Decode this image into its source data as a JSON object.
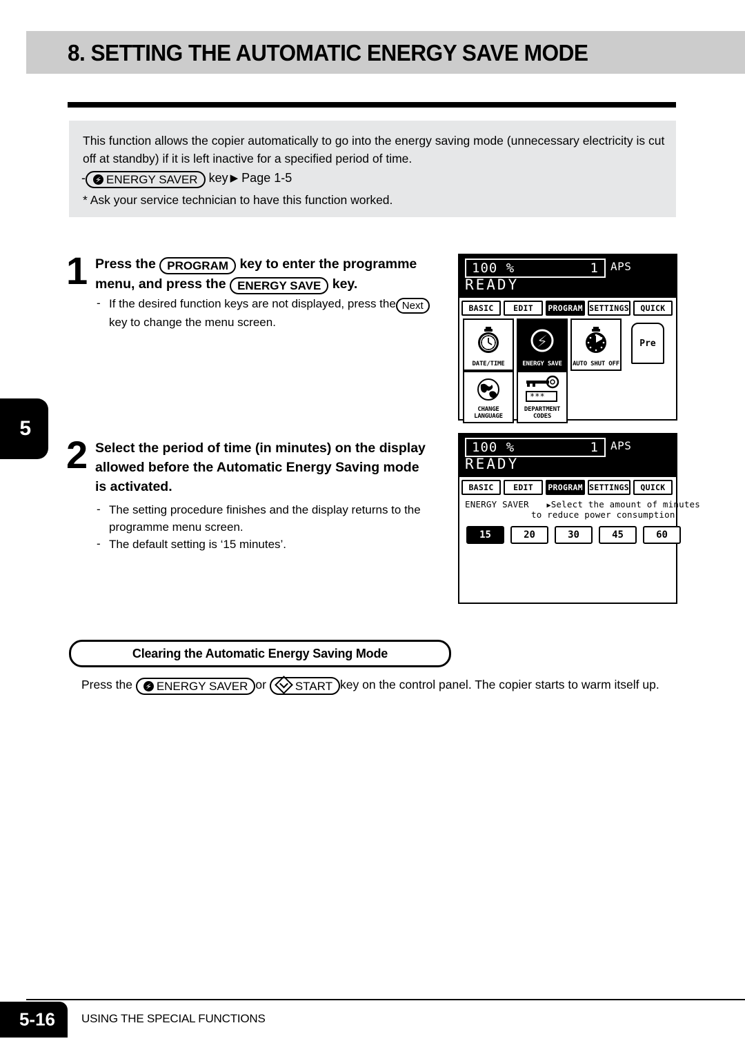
{
  "header": {
    "title": "8. SETTING THE AUTOMATIC ENERGY SAVE MODE"
  },
  "intro": {
    "paragraph": "This function allows the copier automatically to go into the energy saving mode (unnecessary electricity is cut off at standby) if it is left inactive for a specified period of time.",
    "dash": "-",
    "key_label": "ENERGY SAVER",
    "key_icon": "energy-saver-icon",
    "key_suffix": "key",
    "arrow": "▶",
    "page_ref": "Page 1-5",
    "footnote": "* Ask your service technician to have this function worked."
  },
  "chapter_tab": {
    "number": "5"
  },
  "steps": [
    {
      "number": "1",
      "title_line1_a": "Press the",
      "title_key1": "PROGRAM",
      "title_line1_b": "key to enter the programme",
      "title_line2_a": "menu, and press the",
      "title_key2": "ENERGY SAVE",
      "title_line2_b": "key.",
      "note_dash": "-",
      "note_line1_a": "If the desired function keys are not displayed, press the",
      "note_key": "Next",
      "note_line2": "key to change  the menu screen."
    },
    {
      "number": "2",
      "title_line1": "Select the period of time (in minutes) on the display",
      "title_line2": "allowed before the Automatic Energy Saving mode",
      "title_line3": "is activated.",
      "notes": [
        {
          "dash": "-",
          "line1": "The setting procedure finishes and the display returns to the",
          "line2": "programme menu screen."
        },
        {
          "dash": "-",
          "line1": "The default setting is ‘15 minutes’.",
          "line2": ""
        }
      ]
    }
  ],
  "lcd_panel_1": {
    "ratio": "100  %",
    "copies": "1",
    "paper_mode": "APS",
    "status": "READY",
    "tabs": [
      {
        "label": "BASIC",
        "active": false
      },
      {
        "label": "EDIT",
        "active": false
      },
      {
        "label": "PROGRAM",
        "active": true
      },
      {
        "label": "SETTINGS",
        "active": false
      },
      {
        "label": "QUICK",
        "active": false
      }
    ],
    "function_keys": [
      {
        "label": "DATE/TIME",
        "icon": "stopwatch-clock-icon",
        "selected": false
      },
      {
        "label": "ENERGY SAVE",
        "icon": "energy-save-circle-icon",
        "selected": true
      },
      {
        "label": "AUTO SHUT OFF",
        "icon": "stopwatch-dark-icon",
        "selected": false
      },
      {
        "label": "CHANGE\nLANGUAGE",
        "label_line1": "CHANGE",
        "label_line2": "LANGUAGE",
        "icon": "globe-icon",
        "selected": false
      },
      {
        "label": "DEPARTMENT CODES",
        "icon": "key-code-icon",
        "selected": false
      }
    ],
    "next_tab_label": "Pre"
  },
  "lcd_panel_2": {
    "ratio": "100  %",
    "copies": "1",
    "paper_mode": "APS",
    "status": "READY",
    "tabs": [
      {
        "label": "BASIC",
        "active": false
      },
      {
        "label": "EDIT",
        "active": false
      },
      {
        "label": "PROGRAM",
        "active": true
      },
      {
        "label": "SETTINGS",
        "active": false
      },
      {
        "label": "QUICK",
        "active": false
      }
    ],
    "prompt_title": "ENERGY SAVER",
    "prompt_marker": "▶",
    "prompt_line1": "Select the amount of minutes",
    "prompt_line2": "to reduce power consumption",
    "minute_options": [
      {
        "value": "15",
        "selected": true
      },
      {
        "value": "20",
        "selected": false
      },
      {
        "value": "30",
        "selected": false
      },
      {
        "value": "45",
        "selected": false
      },
      {
        "value": "60",
        "selected": false
      }
    ]
  },
  "clearing": {
    "badge_title": "Clearing the Automatic Energy Saving Mode",
    "text_a": "Press the",
    "key1_label": "ENERGY SAVER",
    "key1_icon": "energy-saver-icon",
    "text_or": "or",
    "key2_label": "START",
    "key2_icon": "start-diamond-icon",
    "text_b": "key on the control panel. The copier starts to warm itself up."
  },
  "footer": {
    "page_number": "5-16",
    "section": "USING THE SPECIAL FUNCTIONS"
  }
}
